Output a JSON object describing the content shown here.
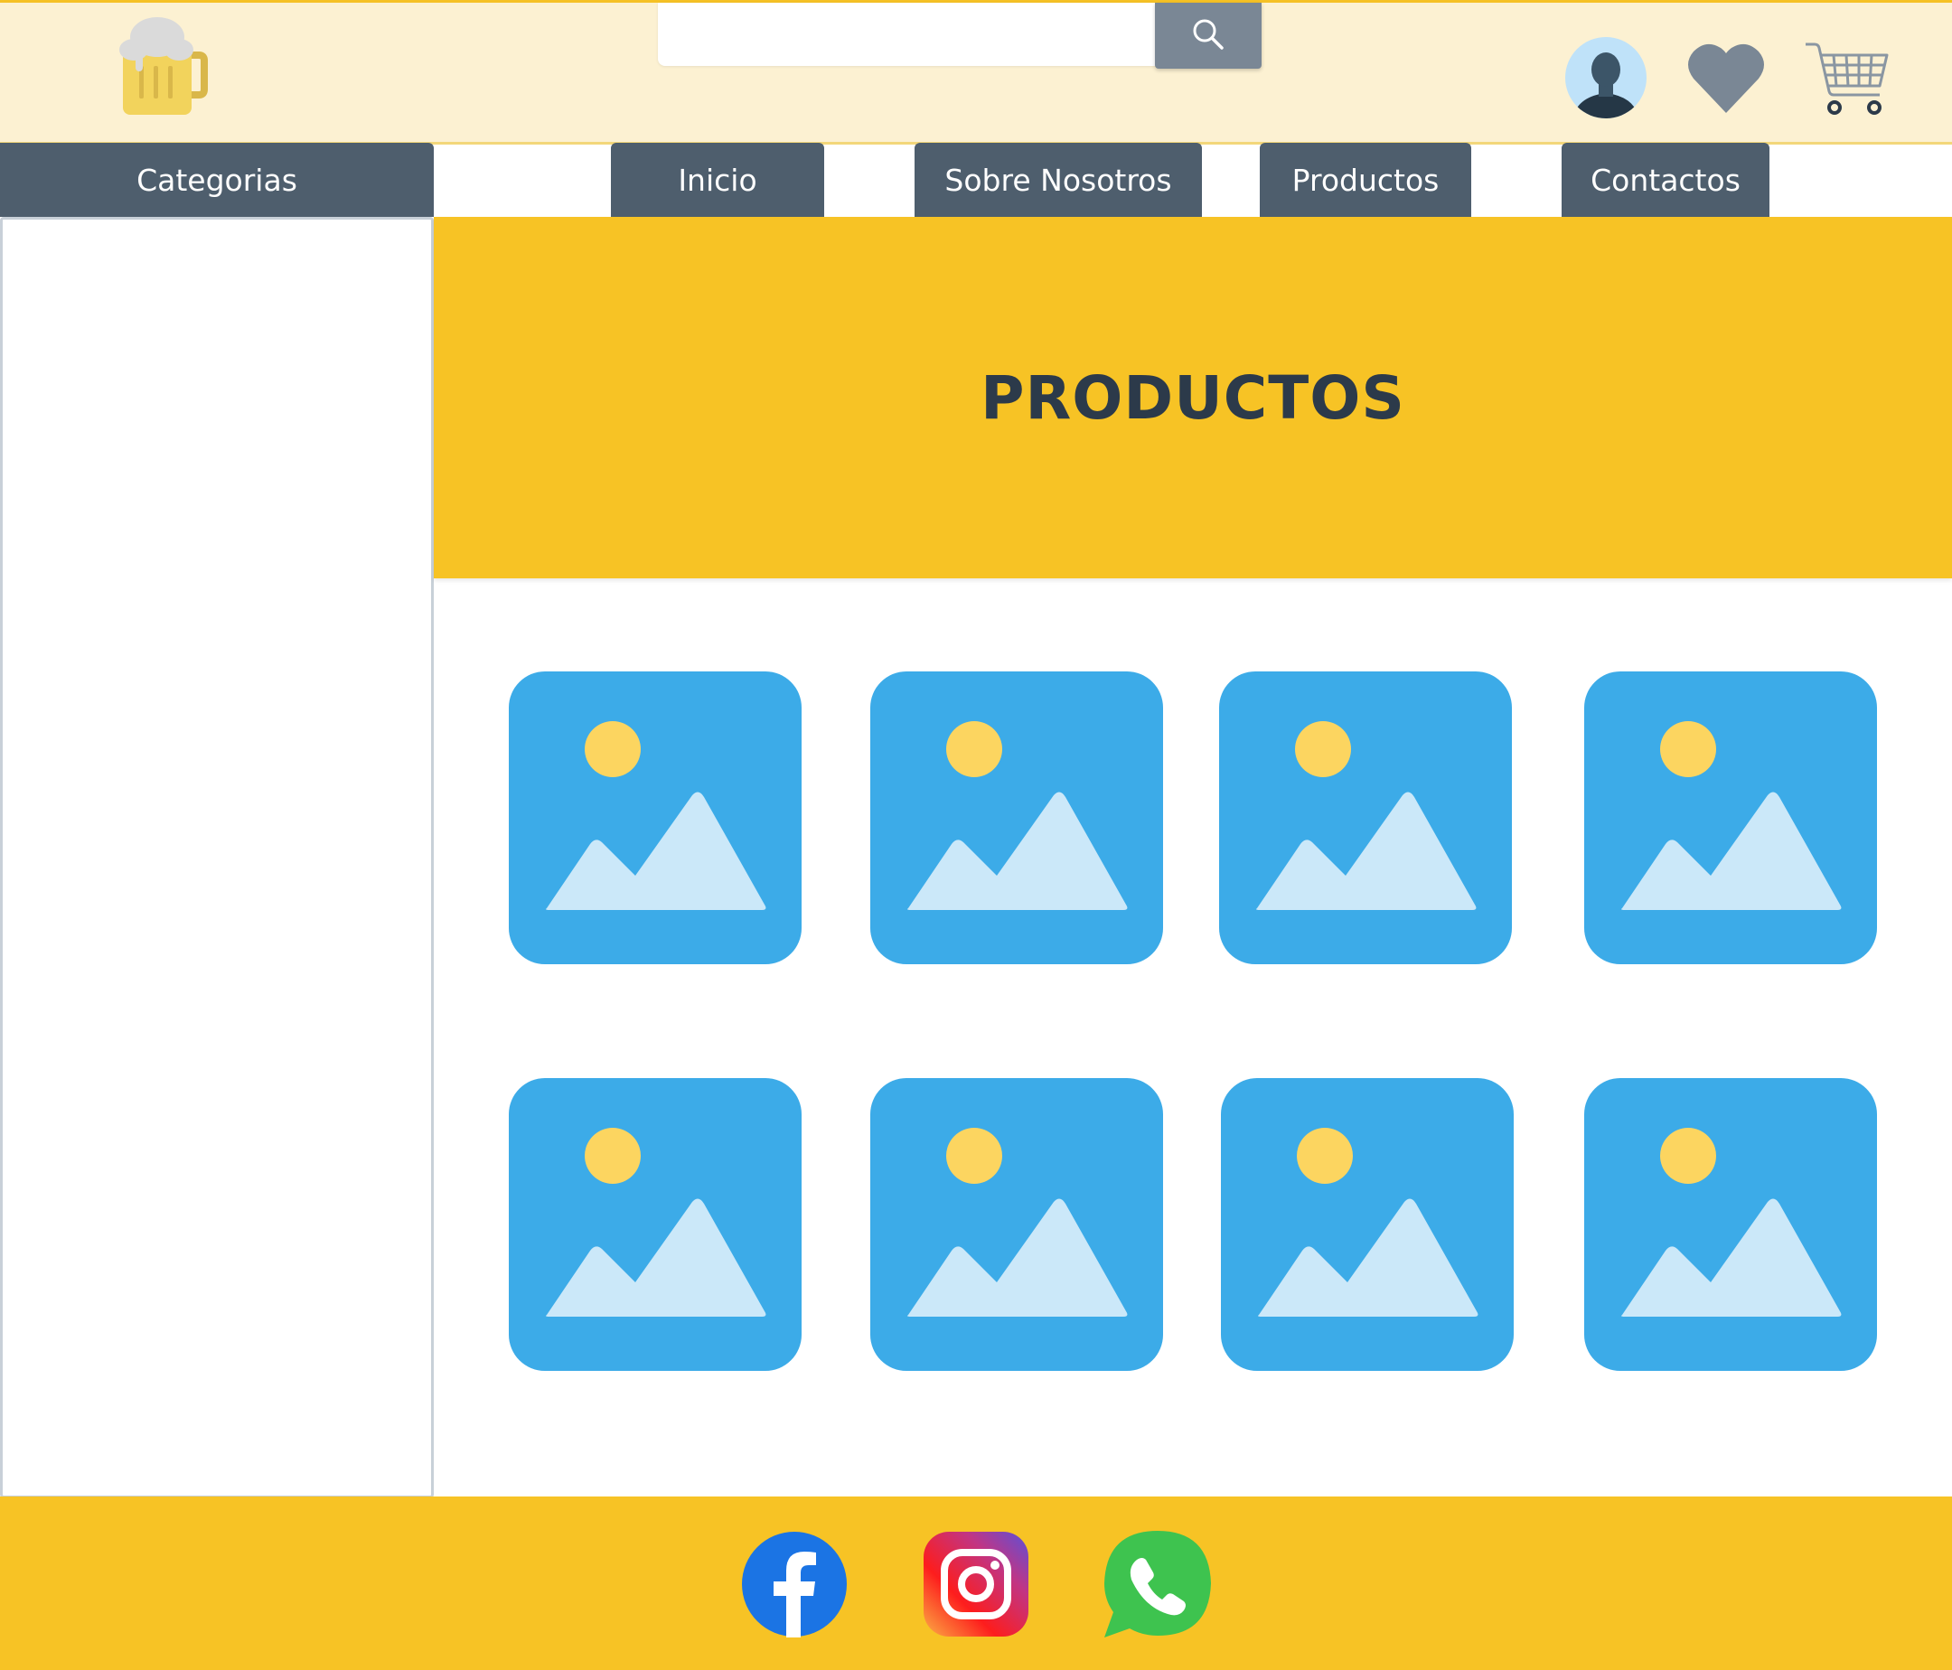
{
  "search": {
    "placeholder": "",
    "value": ""
  },
  "nav": {
    "categorias": "Categorias",
    "inicio": "Inicio",
    "sobre": "Sobre Nosotros",
    "productos": "Productos",
    "contactos": "Contactos"
  },
  "banner": {
    "title": "PRODUCTOS"
  },
  "icons": {
    "logo": "beer-mug-icon",
    "search": "search-icon",
    "account": "user-avatar-icon",
    "favorites": "heart-icon",
    "cart": "shopping-cart-icon",
    "product_placeholder": "image-placeholder-icon",
    "social": [
      "facebook-icon",
      "instagram-icon",
      "whatsapp-icon"
    ]
  },
  "colors": {
    "header_bg": "#fcf1d2",
    "accent_yellow": "#f7c325",
    "nav_bg": "#4e5e6d",
    "title_text": "#2c3a4a",
    "placeholder_blue": "#3cabe8"
  },
  "products": [
    {
      "image": "image-placeholder"
    },
    {
      "image": "image-placeholder"
    },
    {
      "image": "image-placeholder"
    },
    {
      "image": "image-placeholder"
    },
    {
      "image": "image-placeholder"
    },
    {
      "image": "image-placeholder"
    },
    {
      "image": "image-placeholder"
    },
    {
      "image": "image-placeholder"
    }
  ]
}
